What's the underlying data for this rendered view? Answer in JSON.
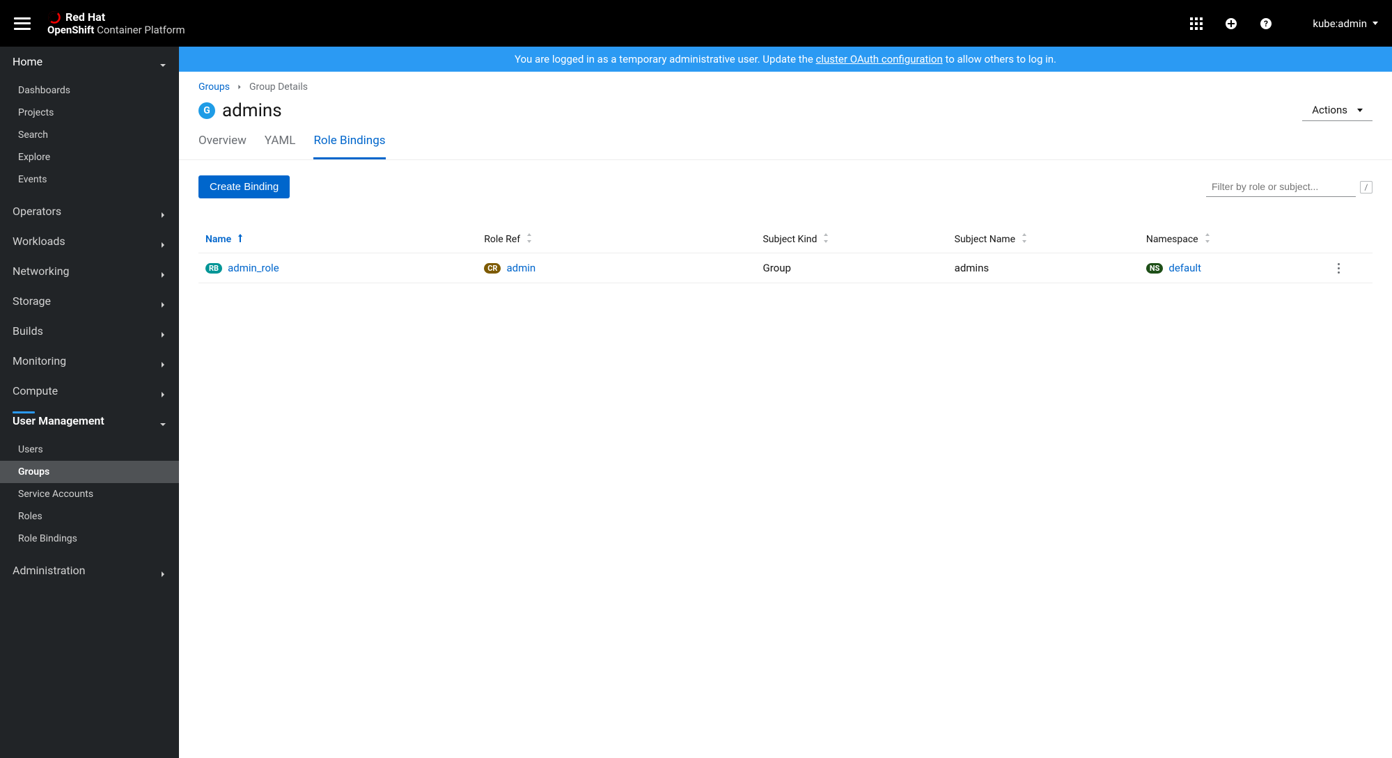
{
  "header": {
    "brand1": "Red Hat",
    "brand_bold": "OpenShift",
    "brand_rest": " Container Platform",
    "user": "kube:admin"
  },
  "banner": {
    "text1": "You are logged in as a temporary administrative user. Update the ",
    "link": "cluster OAuth configuration",
    "text2": " to allow others to log in."
  },
  "sidebar": {
    "home": {
      "label": "Home",
      "items": [
        "Dashboards",
        "Projects",
        "Search",
        "Explore",
        "Events"
      ]
    },
    "sections": [
      "Operators",
      "Workloads",
      "Networking",
      "Storage",
      "Builds",
      "Monitoring",
      "Compute"
    ],
    "usermgmt": {
      "label": "User Management",
      "items": [
        "Users",
        "Groups",
        "Service Accounts",
        "Roles",
        "Role Bindings"
      ],
      "active": "Groups"
    },
    "admin": "Administration"
  },
  "breadcrumb": {
    "root": "Groups",
    "current": "Group Details"
  },
  "page": {
    "badge": "G",
    "title": "admins",
    "actions": "Actions"
  },
  "tabs": [
    "Overview",
    "YAML",
    "Role Bindings"
  ],
  "active_tab": "Role Bindings",
  "toolbar": {
    "create": "Create Binding",
    "filter_placeholder": "Filter by role or subject...",
    "slash": "/"
  },
  "table": {
    "columns": [
      "Name",
      "Role Ref",
      "Subject Kind",
      "Subject Name",
      "Namespace"
    ],
    "rows": [
      {
        "name_badge": "RB",
        "name": "admin_role",
        "roleref_badge": "CR",
        "roleref": "admin",
        "subject_kind": "Group",
        "subject_name": "admins",
        "ns_badge": "NS",
        "namespace": "default"
      }
    ]
  }
}
